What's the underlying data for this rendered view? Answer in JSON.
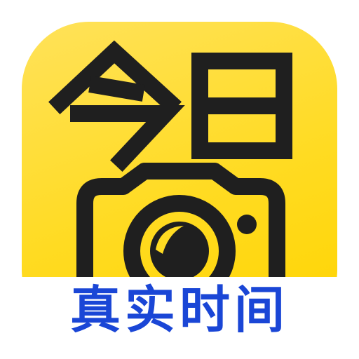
{
  "app_icon": {
    "title": "今日",
    "caption": "真实时间",
    "icon_name": "camera-icon",
    "colors": {
      "tile_yellow": "#ffdb22",
      "ink": "#1f1f1f",
      "caption_blue": "#1a46d6",
      "background": "#ffffff"
    }
  }
}
